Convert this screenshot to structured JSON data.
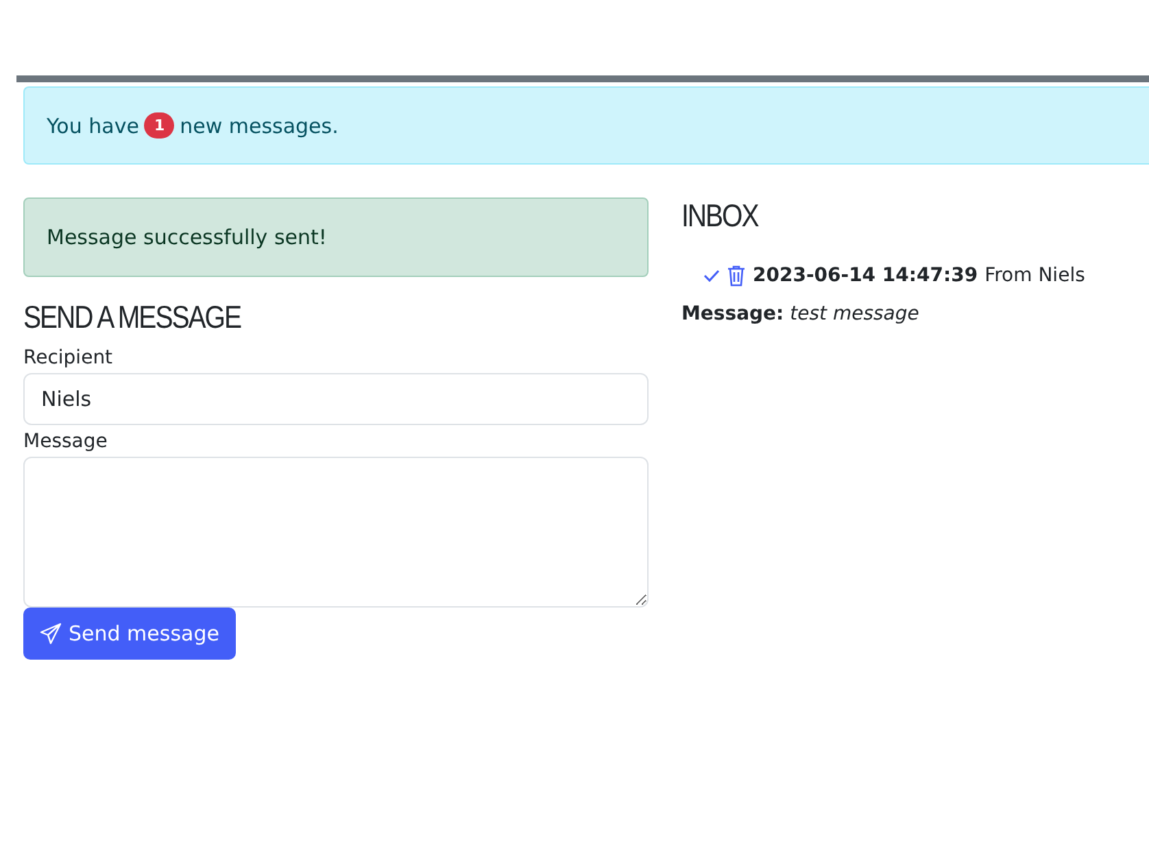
{
  "notice": {
    "before": "You have",
    "count": "1",
    "after": "new messages."
  },
  "success_alert": "Message successfully sent!",
  "send_form": {
    "title": "SEND A MESSAGE",
    "fields": [
      {
        "kind": "input",
        "label": "Recipient",
        "value": "Niels"
      },
      {
        "kind": "textarea",
        "label": "Message"
      }
    ],
    "button": "Send message"
  },
  "inbox": {
    "title": "INBOX",
    "messages": [
      {
        "timestamp": "2023-06-14 14:47:39",
        "from": "From Niels",
        "body_label": "Message:",
        "body": "test message"
      }
    ]
  }
}
